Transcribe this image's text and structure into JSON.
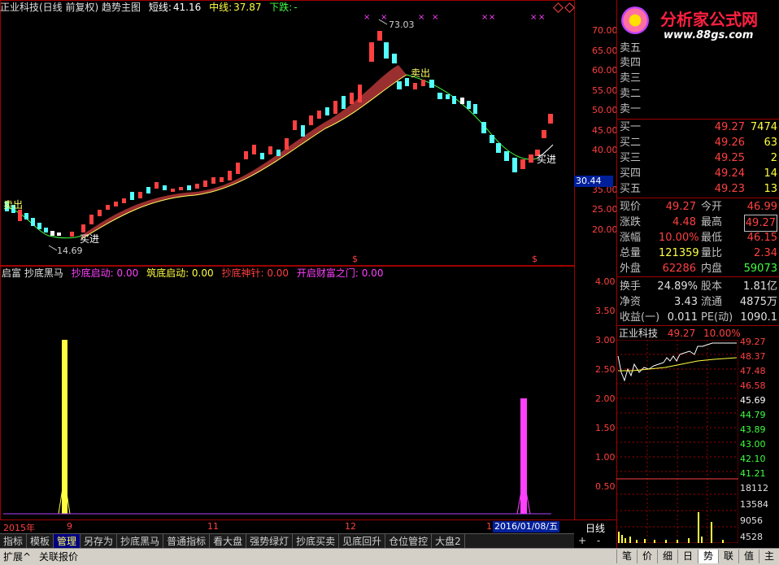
{
  "header": {
    "title": "正业科技(日线 前复权) 趋势主图",
    "short_label": "短线:",
    "short_value": "41.16",
    "mid_label": "中线:",
    "mid_value": "37.87",
    "trend": "下跌:",
    "trend_value": "-"
  },
  "brand": {
    "name": "分析家公式网",
    "url": "www.88gs.com"
  },
  "price_axis": [
    "70.00",
    "65.00",
    "60.00",
    "55.00",
    "50.00",
    "45.00",
    "40.00",
    "35.00",
    "30.44",
    "25.00",
    "20.00"
  ],
  "price_current_label": "30.44",
  "annotations": {
    "high": "73.03",
    "low": "14.69",
    "sell": "卖出",
    "buy": "买进",
    "dollar": "$"
  },
  "indicator": {
    "name": "启富 抄底黑马",
    "items": [
      {
        "label": "抄底启动: 0.00",
        "color": "#ff40ff"
      },
      {
        "label": "筑底启动: 0.00",
        "color": "#ffff40"
      },
      {
        "label": "抄底神针: 0.00",
        "color": "#ff4040"
      },
      {
        "label": "开启财富之门: 0.00",
        "color": "#ff40ff"
      }
    ],
    "axis": [
      "4.00",
      "3.50",
      "3.00",
      "2.50",
      "2.00",
      "1.50",
      "1.00",
      "0.50"
    ]
  },
  "time_axis": {
    "labels": [
      "2015年",
      "9",
      "11",
      "12",
      "1"
    ],
    "cursor_date": "2016/01/08/五",
    "period": "日线"
  },
  "order_book": {
    "sell": [
      {
        "label": "卖五",
        "price": "",
        "vol": ""
      },
      {
        "label": "卖四",
        "price": "",
        "vol": ""
      },
      {
        "label": "卖三",
        "price": "",
        "vol": ""
      },
      {
        "label": "卖二",
        "price": "",
        "vol": ""
      },
      {
        "label": "卖一",
        "price": "",
        "vol": ""
      }
    ],
    "buy": [
      {
        "label": "买一",
        "price": "49.27",
        "vol": "7474"
      },
      {
        "label": "买二",
        "price": "49.26",
        "vol": "63"
      },
      {
        "label": "买三",
        "price": "49.25",
        "vol": "2"
      },
      {
        "label": "买四",
        "price": "49.24",
        "vol": "14"
      },
      {
        "label": "买五",
        "price": "49.23",
        "vol": "13"
      }
    ]
  },
  "quote": [
    {
      "l1": "现价",
      "v1": "49.27",
      "c1": "#ff4040",
      "l2": "今开",
      "v2": "46.99",
      "c2": "#ff4040"
    },
    {
      "l1": "涨跌",
      "v1": "4.48",
      "c1": "#ff4040",
      "l2": "最高",
      "v2": "49.27",
      "c2": "#ff4040"
    },
    {
      "l1": "涨幅",
      "v1": "10.00%",
      "c1": "#ff4040",
      "l2": "最低",
      "v2": "46.15",
      "c2": "#ff4040"
    },
    {
      "l1": "总量",
      "v1": "121359",
      "c1": "#ffff40",
      "l2": "量比",
      "v2": "2.34",
      "c2": "#ff4040"
    },
    {
      "l1": "外盘",
      "v1": "62286",
      "c1": "#ff4040",
      "l2": "内盘",
      "v2": "59073",
      "c2": "#40ff40"
    }
  ],
  "stats": [
    {
      "l1": "换手",
      "v1": "24.89%",
      "l2": "股本",
      "v2": "1.81亿"
    },
    {
      "l1": "净资",
      "v1": "3.43",
      "l2": "流通",
      "v2": "4875万"
    },
    {
      "l1": "收益(一)",
      "v1": "0.011",
      "l2": "PE(动)",
      "v2": "1090.1"
    }
  ],
  "mini_chart": {
    "name": "正业科技",
    "price": "49.27",
    "pct": "10.00%",
    "axis": [
      "49.27",
      "48.37",
      "47.48",
      "46.58",
      "45.69",
      "44.79",
      "43.89",
      "43.00",
      "42.10",
      "41.21"
    ],
    "vol_axis": [
      "18112",
      "13584",
      "9056",
      "4528"
    ]
  },
  "tabs": [
    "指标",
    "模板",
    "管理",
    "另存为",
    "抄底黑马",
    "普通指标",
    "看大盘",
    "强势绿灯",
    "抄底买卖",
    "见底回升",
    "仓位管控",
    "大盘2"
  ],
  "active_tab": "管理",
  "bottom": {
    "expand": "扩展^",
    "report": "关联报价",
    "plus": "+",
    "minus": "-"
  },
  "right_tabs": [
    "笔",
    "价",
    "细",
    "日",
    "势",
    "联",
    "值",
    "主"
  ],
  "right_active": "势",
  "colors": {
    "up": "#ff4040",
    "down": "#54ffff",
    "band": "#9a2f2f",
    "accent": "#ffff40"
  }
}
